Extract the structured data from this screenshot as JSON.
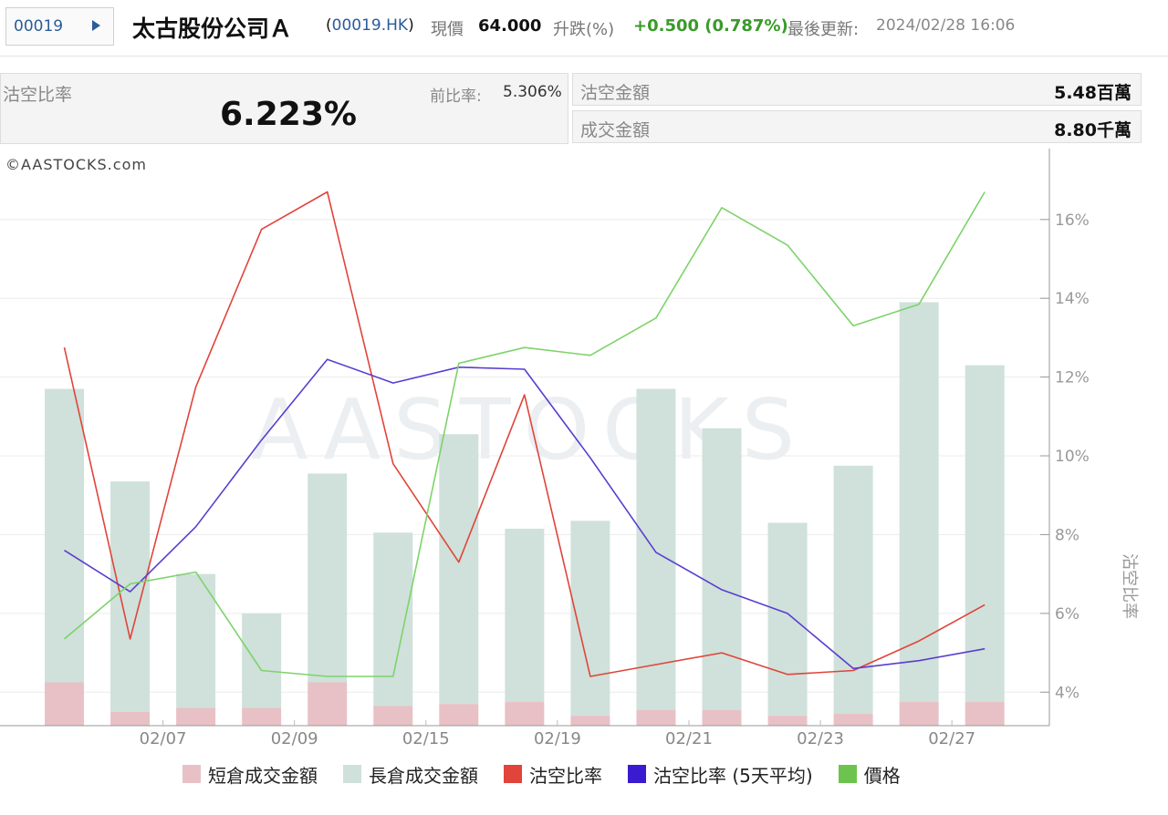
{
  "header": {
    "code_input": "00019",
    "name": "太古股份公司Ａ",
    "code_paren_open": "(",
    "code": "00019.HK",
    "code_paren_close": ")",
    "price_label": "現價",
    "price": "64.000",
    "change_label": "升跌(%)",
    "change": "+0.500 (0.787%)",
    "updated_label": "最後更新:",
    "updated": "2024/02/28 16:06"
  },
  "stats": {
    "ratio_label": "沽空比率",
    "ratio_value": "6.223%",
    "prev_label": "前比率:",
    "prev_value": "5.306%",
    "short_amount_label": "沽空金額",
    "short_amount": "5.48百萬",
    "turnover_label": "成交金額",
    "turnover": "8.80千萬"
  },
  "chart": {
    "copyright": "©AASTOCKS.com",
    "watermark": "AASTOCKS",
    "right_axis_title": "沽空比率"
  },
  "legend": {
    "short": "短倉成交金額",
    "long": "長倉成交金額",
    "ratio": "沽空比率",
    "avg": "沽空比率 (5天平均)",
    "price": "價格"
  },
  "colors": {
    "short_bar": "#e8c1c6",
    "long_bar": "#cfe1da",
    "ratio_line": "#e0443a",
    "avg_line": "#5a3dd0",
    "price_line": "#7dd36a",
    "legend_ratio": "#e0443a",
    "legend_avg": "#3a1bd0",
    "legend_price": "#6cc44f"
  },
  "chart_data": {
    "type": "bar",
    "x_tick_labels": [
      "02/07",
      "02/09",
      "02/15",
      "02/19",
      "02/21",
      "02/23",
      "02/27"
    ],
    "y_right_ticks": [
      "4%",
      "6%",
      "8%",
      "10%",
      "12%",
      "14%",
      "16%"
    ],
    "ylim_right": [
      3.15,
      17.8
    ],
    "bars_total": [
      11.7,
      9.35,
      7.0,
      6.0,
      9.55,
      8.05,
      10.55,
      8.15,
      8.35,
      11.7,
      10.7,
      8.3,
      9.75,
      13.9,
      12.3
    ],
    "bars_short": [
      4.25,
      3.5,
      3.6,
      3.6,
      4.25,
      3.65,
      3.7,
      3.75,
      3.4,
      3.55,
      3.55,
      3.4,
      3.45,
      3.75,
      3.75
    ],
    "series": [
      {
        "name": "沽空比率",
        "values": [
          12.75,
          5.35,
          11.75,
          15.75,
          16.7,
          9.8,
          7.3,
          11.55,
          4.4,
          4.7,
          5.0,
          4.45,
          4.55,
          5.3,
          6.22
        ]
      },
      {
        "name": "沽空比率 (5天平均)",
        "values": [
          7.6,
          6.55,
          8.2,
          10.4,
          12.45,
          11.85,
          12.25,
          12.2,
          9.95,
          7.55,
          6.6,
          6.0,
          4.6,
          4.8,
          5.1
        ]
      },
      {
        "name": "價格",
        "values": [
          5.35,
          6.75,
          7.05,
          4.55,
          4.4,
          4.4,
          12.35,
          12.75,
          12.55,
          13.5,
          16.3,
          15.35,
          13.3,
          13.85,
          16.7
        ]
      }
    ],
    "grid": true,
    "legend_position": "bottom"
  }
}
